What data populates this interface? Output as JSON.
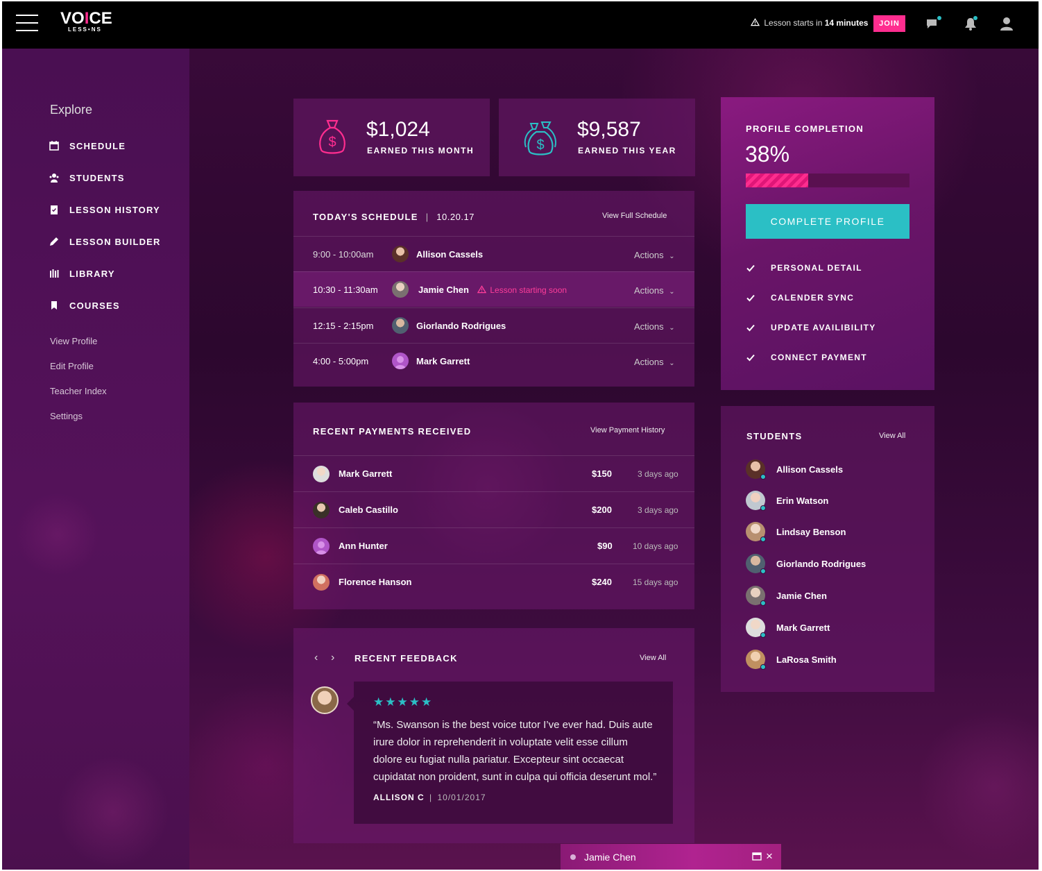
{
  "brand": {
    "name_left": "VO",
    "name_i": "I",
    "name_right": "CE",
    "sub": "LESS•NS"
  },
  "topbar": {
    "alert_prefix": "Lesson starts in",
    "alert_time": "14 minutes",
    "join_label": "JOIN",
    "accent_color": "#ff2d8f"
  },
  "sidebar": {
    "explore_label": "Explore",
    "items": [
      {
        "label": "SCHEDULE",
        "icon": "calendar-icon"
      },
      {
        "label": "STUDENTS",
        "icon": "students-icon"
      },
      {
        "label": "LESSON HISTORY",
        "icon": "clipboard-icon"
      },
      {
        "label": "LESSON BUILDER",
        "icon": "pencil-icon"
      },
      {
        "label": "LIBRARY",
        "icon": "library-icon"
      },
      {
        "label": "COURSES",
        "icon": "bookmark-icon"
      }
    ],
    "links": [
      "View Profile",
      "Edit Profile",
      "Teacher Index",
      "Settings"
    ]
  },
  "stats": [
    {
      "value": "$1,024",
      "label": "EARNED THIS MONTH",
      "icon": "money-bag-icon",
      "color": "#ff2d8f"
    },
    {
      "value": "$9,587",
      "label": "EARNED THIS YEAR",
      "icon": "money-bags-icon",
      "color": "#2bbfc5"
    }
  ],
  "schedule": {
    "title": "TODAY'S SCHEDULE",
    "date": "10.20.17",
    "link": "View Full Schedule",
    "rows": [
      {
        "time": "9:00 - 10:00am",
        "name": "Allison Cassels",
        "actions": "Actions",
        "warning": ""
      },
      {
        "time": "10:30 - 11:30am",
        "name": "Jamie Chen",
        "actions": "Actions",
        "warning": "Lesson starting soon"
      },
      {
        "time": "12:15 - 2:15pm",
        "name": "Giorlando Rodrigues",
        "actions": "Actions",
        "warning": ""
      },
      {
        "time": "4:00 - 5:00pm",
        "name": "Mark Garrett",
        "actions": "Actions",
        "warning": ""
      }
    ]
  },
  "payments": {
    "title": "RECENT PAYMENTS RECEIVED",
    "link": "View Payment History",
    "rows": [
      {
        "name": "Mark Garrett",
        "amount": "$150",
        "ago": "3 days ago"
      },
      {
        "name": "Caleb Castillo",
        "amount": "$200",
        "ago": "3 days ago"
      },
      {
        "name": "Ann Hunter",
        "amount": "$90",
        "ago": "10 days ago"
      },
      {
        "name": "Florence Hanson",
        "amount": "$240",
        "ago": "15 days ago"
      }
    ]
  },
  "feedback": {
    "title": "RECENT FEEDBACK",
    "link": "View All",
    "stars": "★★★★★",
    "rating": 5,
    "quote": "“Ms. Swanson is the best voice tutor I’ve ever had.  Duis aute irure dolor in reprehenderit in voluptate velit esse cillum dolore eu fugiat nulla pariatur. Excepteur sint occaecat cupidatat non proident, sunt in culpa qui officia deserunt mol.”",
    "author": "ALLISON C",
    "date": "10/01/2017"
  },
  "profile": {
    "title": "PROFILE COMPLETION",
    "percent_label": "38%",
    "percent": 38,
    "button": "COMPLETE PROFILE",
    "checklist": [
      "PERSONAL DETAIL",
      "CALENDER SYNC",
      "UPDATE AVAILIBILITY",
      "CONNECT PAYMENT"
    ]
  },
  "students": {
    "title": "STUDENTS",
    "link": "View All",
    "list": [
      "Allison Cassels",
      "Erin Watson",
      "Lindsay Benson",
      "Giorlando Rodrigues",
      "Jamie Chen",
      "Mark Garrett",
      "LaRosa Smith"
    ]
  },
  "chat": {
    "name": "Jamie Chen"
  }
}
